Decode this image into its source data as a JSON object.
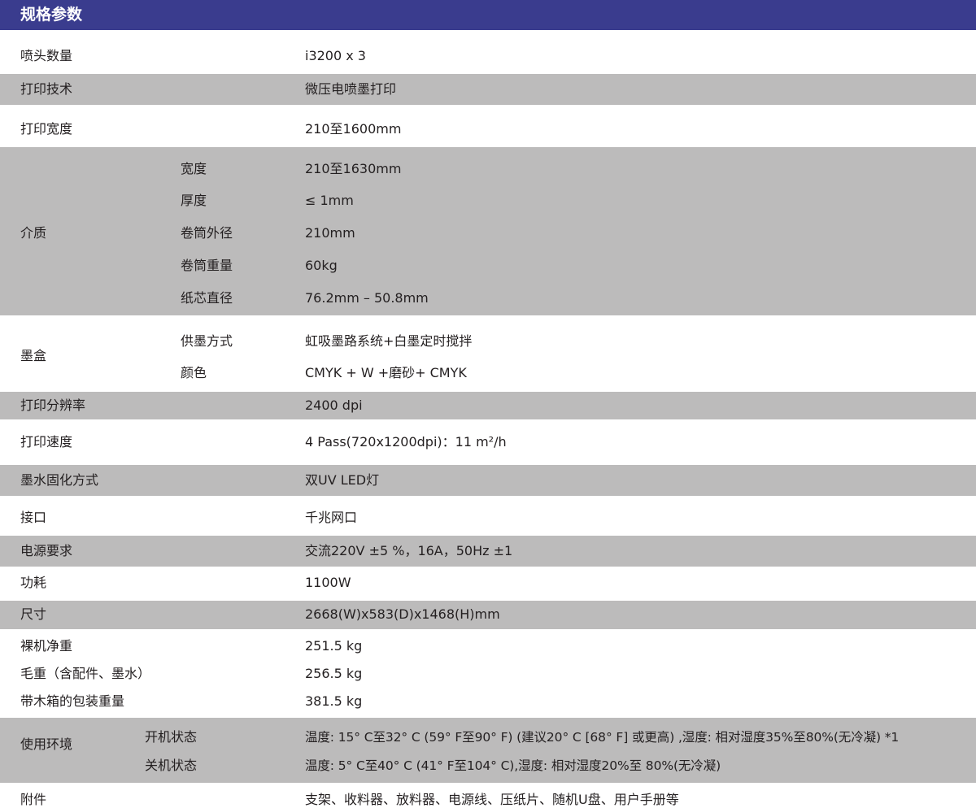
{
  "title": "规格参数",
  "specs": {
    "nozzle_count": {
      "label": "喷头数量",
      "value": "i3200 x 3"
    },
    "print_tech": {
      "label": "打印技术",
      "value": "微压电喷墨打印"
    },
    "print_width": {
      "label": "打印宽度",
      "value": "210至1600mm"
    },
    "media": {
      "label": "介质",
      "items": [
        {
          "label": "宽度",
          "value": "210至1630mm"
        },
        {
          "label": "厚度",
          "value": "≤ 1mm"
        },
        {
          "label": "卷筒外径",
          "value": "210mm"
        },
        {
          "label": "卷筒重量",
          "value": "60kg"
        },
        {
          "label": "纸芯直径",
          "value": "76.2mm – 50.8mm"
        }
      ]
    },
    "ink_box": {
      "label": "墨盒",
      "items": [
        {
          "label": "供墨方式",
          "value": "虹吸墨路系统+白墨定时搅拌"
        },
        {
          "label": "颜色",
          "value": "CMYK + W +磨砂+ CMYK"
        }
      ]
    },
    "resolution": {
      "label": "打印分辨率",
      "value": "2400 dpi"
    },
    "speed": {
      "label": "打印速度",
      "value": "4 Pass(720x1200dpi)：11 m²/h"
    },
    "curing": {
      "label": "墨水固化方式",
      "value": "双UV LED灯"
    },
    "interface": {
      "label": "接口",
      "value": "千兆网口"
    },
    "power": {
      "label": "电源要求",
      "value": "交流220V ±5 %，16A，50Hz ±1"
    },
    "consumption": {
      "label": "功耗",
      "value": "1100W"
    },
    "dimensions": {
      "label": "尺寸",
      "value": "2668(W)x583(D)x1468(H)mm"
    },
    "net_weight": {
      "label": "裸机净重",
      "value": "251.5 kg"
    },
    "gross_weight": {
      "label": "毛重（含配件、墨水）",
      "value": "256.5 kg"
    },
    "packed_weight": {
      "label": "带木箱的包装重量",
      "value": "381.5 kg"
    },
    "environment": {
      "label": "使用环境",
      "items": [
        {
          "label": "开机状态",
          "value": "温度: 15° C至32° C (59° F至90° F) (建议20° C [68° F] 或更高) ,湿度: 相对湿度35%至80%(无冷凝) *1"
        },
        {
          "label": "关机状态",
          "value": "温度: 5° C至40° C (41° F至104° C),湿度: 相对湿度20%至 80%(无冷凝)"
        }
      ]
    },
    "accessories": {
      "label": "附件",
      "value": "支架、收料器、放料器、电源线、压纸片、随机U盘、用户手册等"
    }
  },
  "colors": {
    "header": "#3a3c8e",
    "band": "#bcbbbb",
    "text": "#231f20"
  }
}
